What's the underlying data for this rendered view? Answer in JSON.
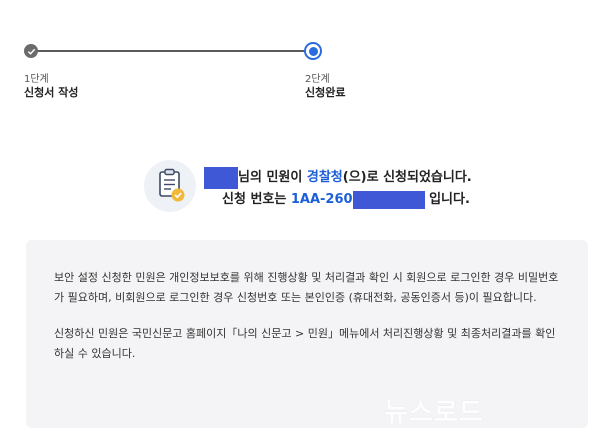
{
  "stepper": {
    "steps": [
      {
        "number": "1단계",
        "name": "신청서 작성",
        "status": "done"
      },
      {
        "number": "2단계",
        "name": "신청완료",
        "status": "active"
      }
    ]
  },
  "result": {
    "line1": {
      "after_name": "님의 민원이 ",
      "agency": "경찰청",
      "tail": "(으)로 신청되었습니다."
    },
    "line2": {
      "prefix": "신청 번호는 ",
      "number_visible": "1AA-260",
      "suffix": " 입니다."
    }
  },
  "notice": {
    "paragraph1": "보안 설정 신청한 민원은 개인정보보호를 위해 진행상황 및 처리결과 확인 시 회원으로 로그인한 경우 비밀번호가 필요하며, 비회원으로 로그인한 경우 신청번호 또는 본인인증 (휴대전화, 공동인증서 등)이 필요합니다.",
    "paragraph2": "신청하신 민원은 국민신문고 홈페이지「나의 신문고 > 민원」메뉴에서 처리진행상황 및 최종처리결과를 확인하실 수 있습니다."
  },
  "watermark": {
    "text": "뉴스로드"
  },
  "colors": {
    "accent": "#2a6bdf",
    "agency_text": "#1d5fd8",
    "redaction": "#3f58d6",
    "notice_bg": "#f4f4f6"
  }
}
